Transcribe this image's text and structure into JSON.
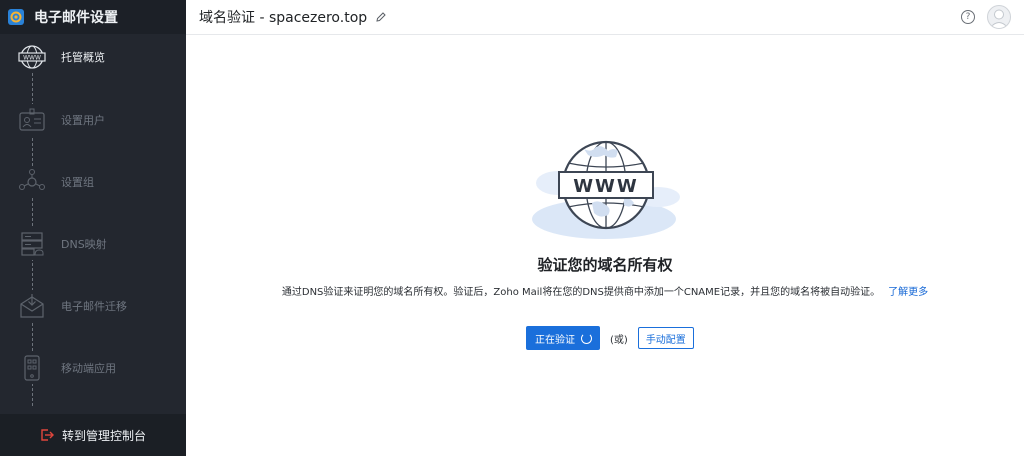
{
  "sidebar": {
    "title": "电子邮件设置",
    "steps": [
      {
        "label": "托管概览",
        "icon": "www-globe-icon",
        "active": true
      },
      {
        "label": "设置用户",
        "icon": "user-card-icon",
        "active": false
      },
      {
        "label": "设置组",
        "icon": "group-icon",
        "active": false
      },
      {
        "label": "DNS映射",
        "icon": "dns-server-icon",
        "active": false
      },
      {
        "label": "电子邮件迁移",
        "icon": "mail-migration-icon",
        "active": false
      },
      {
        "label": "移动端应用",
        "icon": "mobile-app-icon",
        "active": false
      }
    ],
    "footer_label": "转到管理控制台"
  },
  "header": {
    "title": "域名验证 - spacezero.top",
    "help_glyph": "?"
  },
  "main": {
    "illustration_text": "WWW",
    "heading": "验证您的域名所有权",
    "description": "通过DNS验证来证明您的域名所有权。验证后，Zoho Mail将在您的DNS提供商中添加一个CNAME记录，并且您的域名将被自动验证。",
    "learn_more": "了解更多",
    "verify_button": "正在验证",
    "or_text": "(或)",
    "manual_button": "手动配置"
  },
  "colors": {
    "sidebar_bg": "#23272f",
    "primary": "#1a6fdb",
    "link": "#1668d6"
  }
}
